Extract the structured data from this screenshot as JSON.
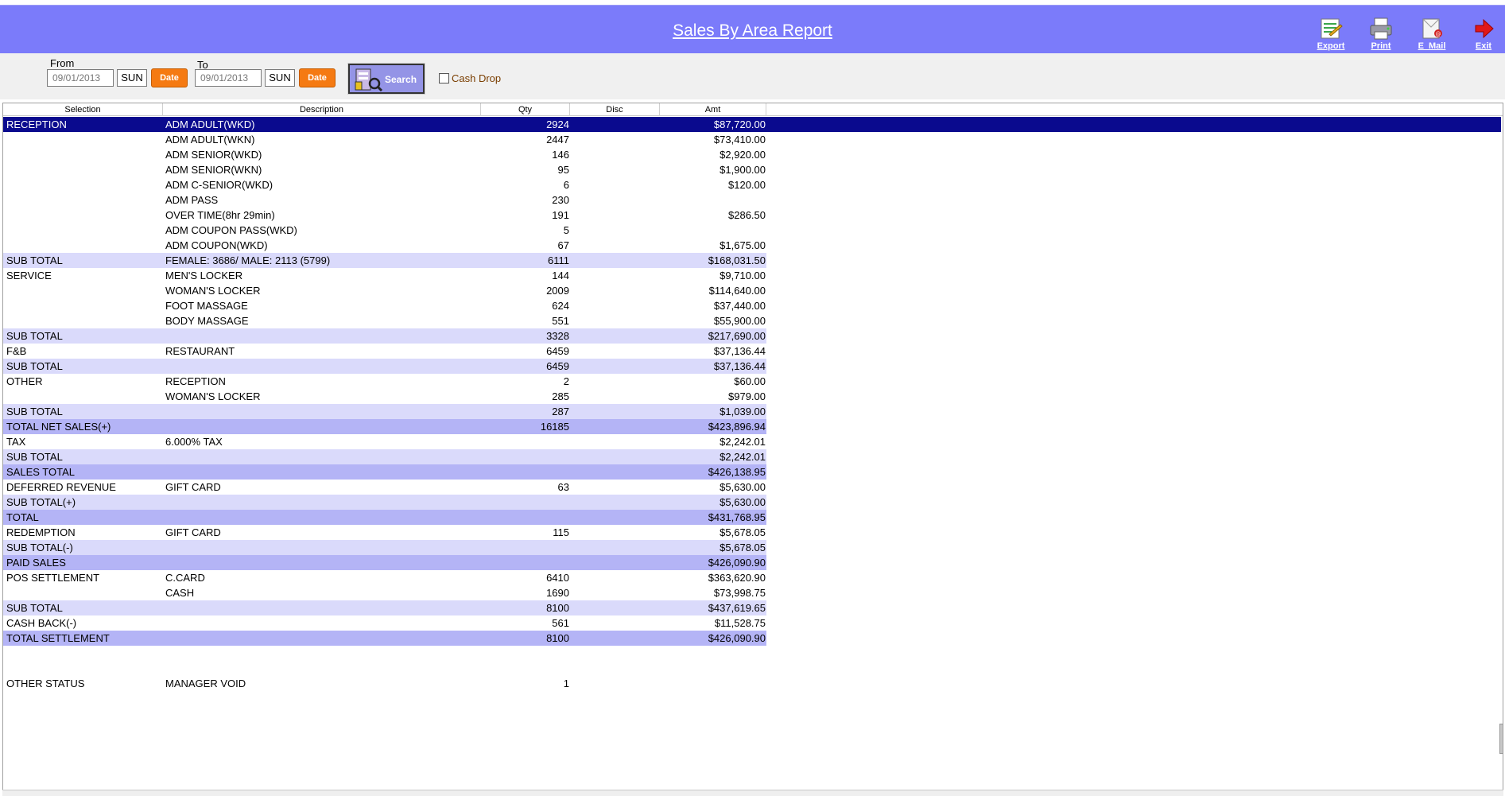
{
  "header": {
    "title": "Sales By Area Report",
    "tools": [
      {
        "label": "Export",
        "icon": "export-icon"
      },
      {
        "label": "Print",
        "icon": "printer-icon"
      },
      {
        "label": "E_Mail",
        "icon": "email-icon"
      },
      {
        "label": "Exit",
        "icon": "exit-arrow-icon"
      }
    ]
  },
  "filter": {
    "from_label": "From",
    "from_date": "09/01/2013",
    "from_day": "SUN",
    "to_label": "To",
    "to_date": "09/01/2013",
    "to_day": "SUN",
    "date_button": "Date",
    "search_label": "Search",
    "cash_drop_label": "Cash Drop",
    "cash_drop_checked": false
  },
  "table": {
    "columns": [
      "Selection",
      "Description",
      "Qty",
      "Disc",
      "Amt"
    ],
    "rows": [
      {
        "style": "selected",
        "sel": "RECEPTION",
        "desc": "ADM ADULT(WKD)",
        "qty": "2924",
        "disc": "",
        "amt": "$87,720.00"
      },
      {
        "style": "",
        "sel": "",
        "desc": "ADM ADULT(WKN)",
        "qty": "2447",
        "disc": "",
        "amt": "$73,410.00"
      },
      {
        "style": "",
        "sel": "",
        "desc": "ADM SENIOR(WKD)",
        "qty": "146",
        "disc": "",
        "amt": "$2,920.00"
      },
      {
        "style": "",
        "sel": "",
        "desc": "ADM SENIOR(WKN)",
        "qty": "95",
        "disc": "",
        "amt": "$1,900.00"
      },
      {
        "style": "",
        "sel": "",
        "desc": "ADM C-SENIOR(WKD)",
        "qty": "6",
        "disc": "",
        "amt": "$120.00"
      },
      {
        "style": "",
        "sel": "",
        "desc": "ADM PASS",
        "qty": "230",
        "disc": "",
        "amt": ""
      },
      {
        "style": "",
        "sel": "",
        "desc": "OVER TIME(8hr 29min)",
        "qty": "191",
        "disc": "",
        "amt": "$286.50"
      },
      {
        "style": "",
        "sel": "",
        "desc": "ADM COUPON PASS(WKD)",
        "qty": "5",
        "disc": "",
        "amt": ""
      },
      {
        "style": "",
        "sel": "",
        "desc": "ADM COUPON(WKD)",
        "qty": "67",
        "disc": "",
        "amt": "$1,675.00"
      },
      {
        "style": "sub",
        "sel": "SUB TOTAL",
        "desc": "FEMALE: 3686/ MALE: 2113 (5799)",
        "qty": "6111",
        "disc": "",
        "amt": "$168,031.50"
      },
      {
        "style": "",
        "sel": "SERVICE",
        "desc": "MEN'S LOCKER",
        "qty": "144",
        "disc": "",
        "amt": "$9,710.00"
      },
      {
        "style": "",
        "sel": "",
        "desc": "WOMAN'S LOCKER",
        "qty": "2009",
        "disc": "",
        "amt": "$114,640.00"
      },
      {
        "style": "",
        "sel": "",
        "desc": "FOOT MASSAGE",
        "qty": "624",
        "disc": "",
        "amt": "$37,440.00"
      },
      {
        "style": "",
        "sel": "",
        "desc": "BODY MASSAGE",
        "qty": "551",
        "disc": "",
        "amt": "$55,900.00"
      },
      {
        "style": "sub",
        "sel": "SUB TOTAL",
        "desc": "",
        "qty": "3328",
        "disc": "",
        "amt": "$217,690.00"
      },
      {
        "style": "",
        "sel": "F&B",
        "desc": "RESTAURANT",
        "qty": "6459",
        "disc": "",
        "amt": "$37,136.44"
      },
      {
        "style": "sub",
        "sel": "SUB TOTAL",
        "desc": "",
        "qty": "6459",
        "disc": "",
        "amt": "$37,136.44"
      },
      {
        "style": "",
        "sel": "OTHER",
        "desc": "RECEPTION",
        "qty": "2",
        "disc": "",
        "amt": "$60.00"
      },
      {
        "style": "",
        "sel": "",
        "desc": "WOMAN'S LOCKER",
        "qty": "285",
        "disc": "",
        "amt": "$979.00"
      },
      {
        "style": "sub",
        "sel": "SUB TOTAL",
        "desc": "",
        "qty": "287",
        "disc": "",
        "amt": "$1,039.00"
      },
      {
        "style": "total",
        "sel": "TOTAL NET SALES(+)",
        "desc": "",
        "qty": "16185",
        "disc": "",
        "amt": "$423,896.94"
      },
      {
        "style": "",
        "sel": "TAX",
        "desc": "6.000% TAX",
        "qty": "",
        "disc": "",
        "amt": "$2,242.01"
      },
      {
        "style": "sub",
        "sel": "SUB TOTAL",
        "desc": "",
        "qty": "",
        "disc": "",
        "amt": "$2,242.01"
      },
      {
        "style": "total",
        "sel": "SALES TOTAL",
        "desc": "",
        "qty": "",
        "disc": "",
        "amt": "$426,138.95"
      },
      {
        "style": "",
        "sel": "DEFERRED REVENUE",
        "desc": "GIFT CARD",
        "qty": "63",
        "disc": "",
        "amt": "$5,630.00"
      },
      {
        "style": "sub",
        "sel": "SUB TOTAL(+)",
        "desc": "",
        "qty": "",
        "disc": "",
        "amt": "$5,630.00"
      },
      {
        "style": "total",
        "sel": "TOTAL",
        "desc": "",
        "qty": "",
        "disc": "",
        "amt": "$431,768.95"
      },
      {
        "style": "",
        "sel": "REDEMPTION",
        "desc": "GIFT CARD",
        "qty": "115",
        "disc": "",
        "amt": "$5,678.05"
      },
      {
        "style": "sub",
        "sel": "SUB TOTAL(-)",
        "desc": "",
        "qty": "",
        "disc": "",
        "amt": "$5,678.05"
      },
      {
        "style": "total",
        "sel": "PAID SALES",
        "desc": "",
        "qty": "",
        "disc": "",
        "amt": "$426,090.90"
      },
      {
        "style": "",
        "sel": "POS SETTLEMENT",
        "desc": "C.CARD",
        "qty": "6410",
        "disc": "",
        "amt": "$363,620.90"
      },
      {
        "style": "",
        "sel": "",
        "desc": "CASH",
        "qty": "1690",
        "disc": "",
        "amt": "$73,998.75"
      },
      {
        "style": "sub",
        "sel": "SUB TOTAL",
        "desc": "",
        "qty": "8100",
        "disc": "",
        "amt": "$437,619.65"
      },
      {
        "style": "",
        "sel": "CASH BACK(-)",
        "desc": "",
        "qty": "561",
        "disc": "",
        "amt": "$11,528.75"
      },
      {
        "style": "total",
        "sel": "TOTAL SETTLEMENT",
        "desc": "",
        "qty": "8100",
        "disc": "",
        "amt": "$426,090.90"
      },
      {
        "style": "blank",
        "sel": "",
        "desc": "",
        "qty": "",
        "disc": "",
        "amt": ""
      },
      {
        "style": "blank",
        "sel": "",
        "desc": "",
        "qty": "",
        "disc": "",
        "amt": ""
      },
      {
        "style": "",
        "sel": "OTHER STATUS",
        "desc": "MANAGER VOID",
        "qty": "1",
        "disc": "",
        "amt": ""
      }
    ]
  },
  "colors": {
    "header_bg": "#7b7bfa",
    "selected_row": "#0a0a8e",
    "subtotal_row": "#dadafb",
    "total_row": "#b4b4f6",
    "date_button": "#f57a12"
  }
}
